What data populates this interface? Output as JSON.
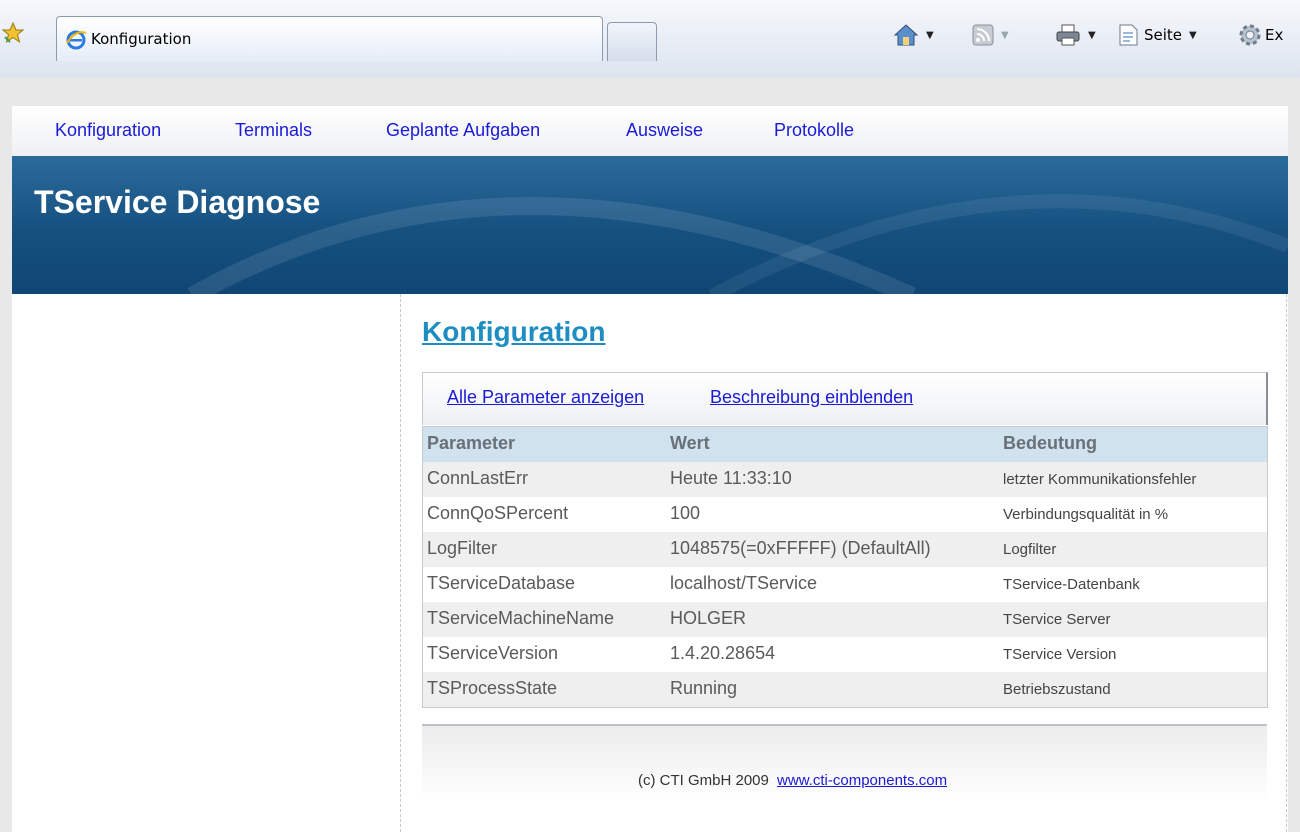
{
  "browser": {
    "tab_title": "Konfiguration",
    "toolbar": {
      "page_label": "Seite",
      "extras_label": "Ex"
    }
  },
  "nav": {
    "items": [
      {
        "label": "Konfiguration"
      },
      {
        "label": "Terminals"
      },
      {
        "label": "Geplante Aufgaben"
      },
      {
        "label": "Ausweise"
      },
      {
        "label": "Protokolle"
      }
    ]
  },
  "banner": {
    "title": "TService Diagnose"
  },
  "main": {
    "heading": "Konfiguration",
    "actions": {
      "show_all": "Alle Parameter anzeigen",
      "show_desc": "Beschreibung einblenden"
    },
    "table": {
      "headers": [
        "Parameter",
        "Wert",
        "Bedeutung"
      ],
      "rows": [
        [
          "ConnLastErr",
          "Heute 11:33:10",
          "letzter Kommunikationsfehler"
        ],
        [
          "ConnQoSPercent",
          "100",
          "Verbindungsqualität in %"
        ],
        [
          "LogFilter",
          "1048575(=0xFFFFF) (DefaultAll)",
          "Logfilter"
        ],
        [
          "TServiceDatabase",
          "localhost/TService",
          "TService-Datenbank"
        ],
        [
          "TServiceMachineName",
          "HOLGER",
          "TService Server"
        ],
        [
          "TServiceVersion",
          "1.4.20.28654",
          "TService Version"
        ],
        [
          "TSProcessState",
          "Running",
          "Betriebszustand"
        ]
      ]
    },
    "footer": {
      "copyright": "(c) CTI GmbH 2009",
      "link": "www.cti-components.com"
    }
  },
  "colors": {
    "banner": "#15507f",
    "heading": "#1e8ec2",
    "link": "#1a1ad8",
    "table_header": "#cfe2ee"
  }
}
